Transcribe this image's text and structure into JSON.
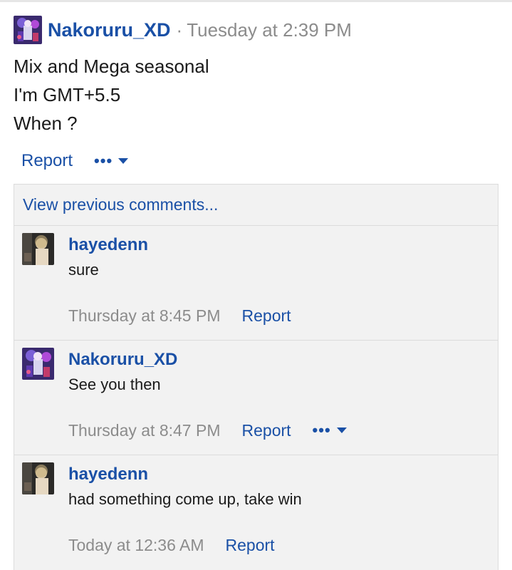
{
  "post": {
    "author": "Nakoruru_XD",
    "separator": "·",
    "time": "Tuesday at 2:39 PM",
    "lines": [
      "Mix and Mega seasonal",
      "I'm GMT+5.5",
      "When ?"
    ],
    "report_label": "Report",
    "more_label": "•••"
  },
  "comments": {
    "view_previous_label": "View previous comments...",
    "items": [
      {
        "author": "hayedenn",
        "text": "sure",
        "time": "Thursday at 8:45 PM",
        "report_label": "Report"
      },
      {
        "author": "Nakoruru_XD",
        "text": "See you then",
        "time": "Thursday at 8:47 PM",
        "report_label": "Report",
        "more_label": "•••"
      },
      {
        "author": "hayedenn",
        "text": "had something come up, take win",
        "time": "Today at 12:36 AM",
        "report_label": "Report"
      }
    ]
  },
  "colors": {
    "link": "#1a50a6",
    "muted": "#8c8c8c",
    "comment_bg": "#f2f2f2",
    "border": "#dcdcdc"
  }
}
